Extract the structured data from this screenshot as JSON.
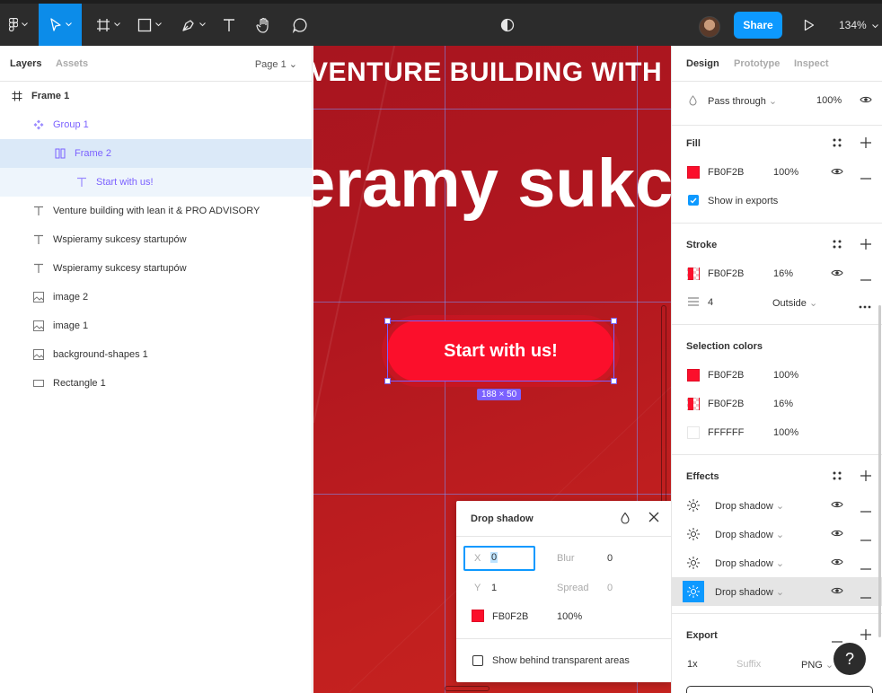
{
  "toolbar": {
    "zoom": "134%",
    "share_label": "Share"
  },
  "layers_panel": {
    "tabs": [
      "Layers",
      "Assets"
    ],
    "page": "Page 1",
    "layers": [
      {
        "name": "Frame 1",
        "icon": "frame-icon"
      },
      {
        "name": "Group 1",
        "icon": "component-icon"
      },
      {
        "name": "Frame 2",
        "icon": "autolayout-frame-icon"
      },
      {
        "name": "Start with us!",
        "icon": "text-icon"
      },
      {
        "name": "Venture building with lean it & PRO ADVISORY",
        "icon": "text-icon"
      },
      {
        "name": "Wspieramy sukcesy startupów",
        "icon": "text-icon"
      },
      {
        "name": "Wspieramy sukcesy startupów",
        "icon": "text-icon"
      },
      {
        "name": "image 2",
        "icon": "image-icon"
      },
      {
        "name": "image 1",
        "icon": "image-icon"
      },
      {
        "name": "background-shapes 1",
        "icon": "image-icon"
      },
      {
        "name": "Rectangle 1",
        "icon": "rectangle-icon"
      }
    ]
  },
  "canvas": {
    "heading_top": "VENTURE BUILDING WITH LE",
    "heading_big": "eramy sukc",
    "cta_label": "Start with us!",
    "dimension_label": "188 × 50"
  },
  "drop_shadow_popup": {
    "title": "Drop shadow",
    "x_label": "X",
    "x_value": "0",
    "y_label": "Y",
    "y_value": "1",
    "blur_label": "Blur",
    "blur_value": "0",
    "spread_label": "Spread",
    "spread_value": "0",
    "color_hex": "FB0F2B",
    "color_opacity": "100%",
    "behind_label": "Show behind transparent areas",
    "color": "#fb0f2b"
  },
  "design_panel": {
    "tabs": [
      "Design",
      "Prototype",
      "Inspect"
    ],
    "layer_blend": "Pass through",
    "layer_opacity": "100%",
    "fill": {
      "title": "Fill",
      "hex": "FB0F2B",
      "opacity": "100%",
      "show_in_exports": "Show in exports"
    },
    "stroke": {
      "title": "Stroke",
      "hex": "FB0F2B",
      "opacity": "16%",
      "weight": "4",
      "position": "Outside"
    },
    "selection_colors": {
      "title": "Selection colors",
      "items": [
        {
          "hex": "FB0F2B",
          "opacity": "100%"
        },
        {
          "hex": "FB0F2B",
          "opacity": "16%"
        },
        {
          "hex": "FFFFFF",
          "opacity": "100%"
        }
      ]
    },
    "effects": {
      "title": "Effects",
      "items": [
        "Drop shadow",
        "Drop shadow",
        "Drop shadow",
        "Drop shadow"
      ]
    },
    "export": {
      "title": "Export",
      "scale": "1x",
      "suffix_placeholder": "Suffix",
      "format": "PNG"
    }
  },
  "help_label": "?"
}
